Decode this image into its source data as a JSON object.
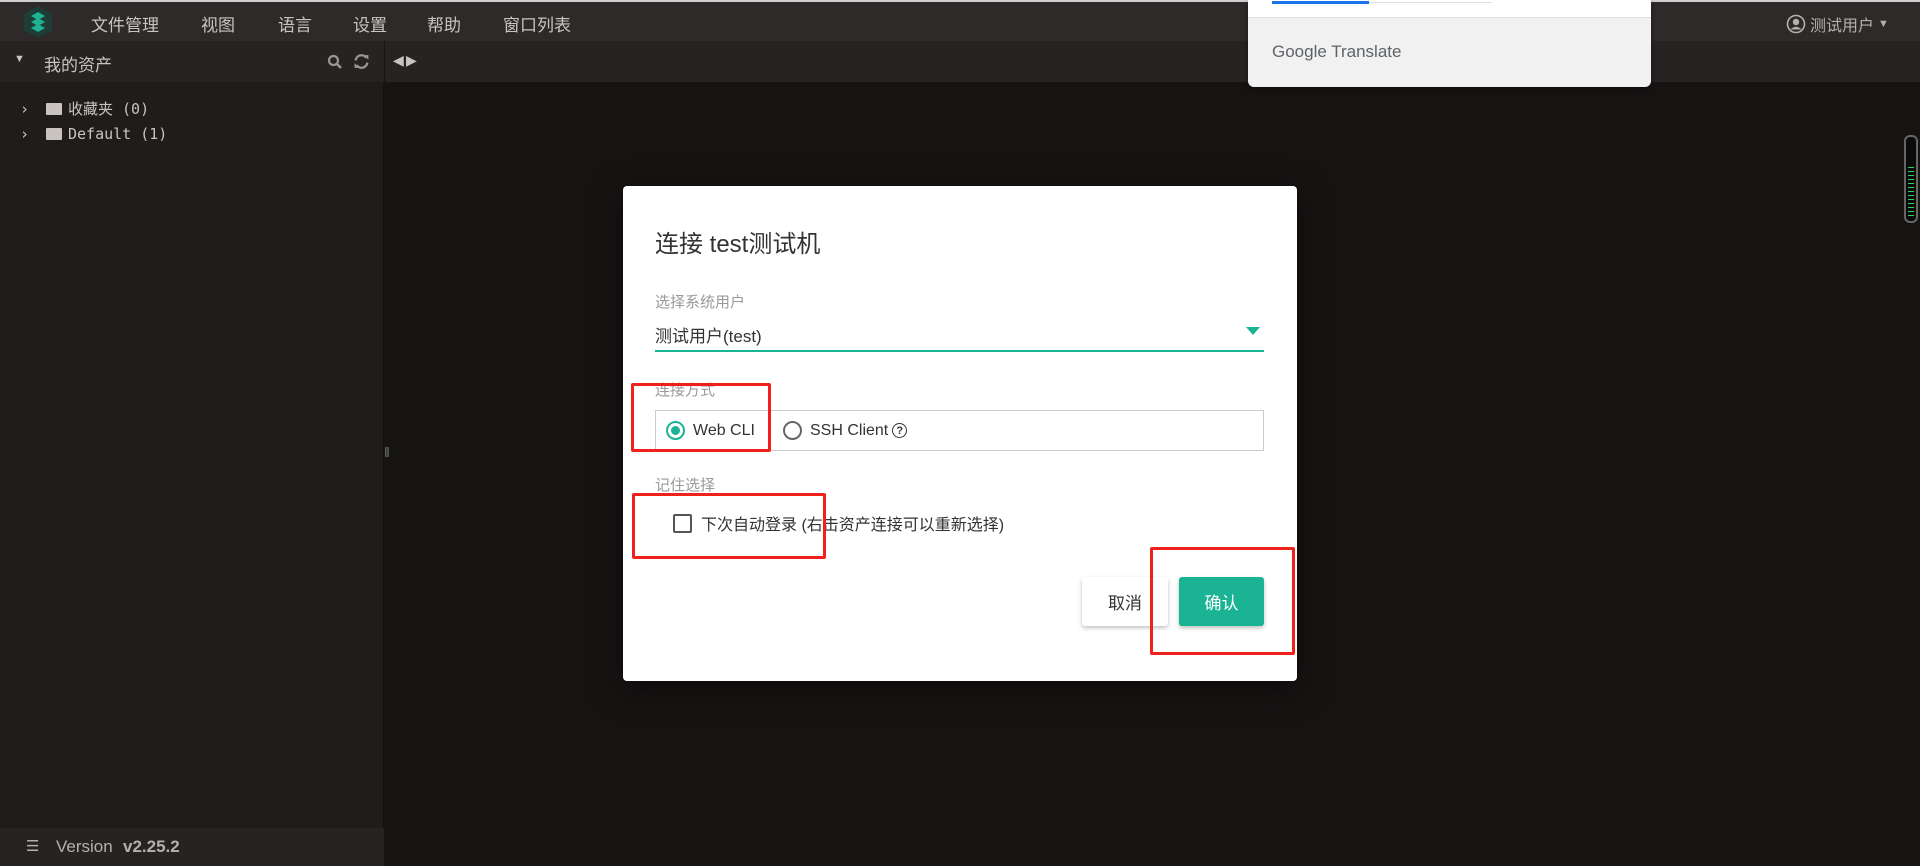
{
  "menu": {
    "items": [
      "文件管理",
      "视图",
      "语言",
      "设置",
      "帮助",
      "窗口列表"
    ],
    "user": "测试用户"
  },
  "sidebar": {
    "title": "我的资产",
    "tree": [
      {
        "label": "收藏夹 (0)"
      },
      {
        "label": "Default (1)"
      }
    ],
    "version_label": "Version",
    "version": "v2.25.2"
  },
  "translate": {
    "brand": "Google Translate"
  },
  "dialog": {
    "title": "连接 test测试机",
    "system_user_label": "选择系统用户",
    "system_user_value": "测试用户(test)",
    "connect_label": "连接方式",
    "options": [
      "Web CLI",
      "SSH Client"
    ],
    "selected": "Web CLI",
    "remember_label": "记住选择",
    "auto_login": "下次自动登录 (右击资产连接可以重新选择)",
    "auto_login_checked": false,
    "cancel": "取消",
    "confirm": "确认"
  },
  "colors": {
    "accent": "#1ab394",
    "highlight": "#f0201a"
  }
}
